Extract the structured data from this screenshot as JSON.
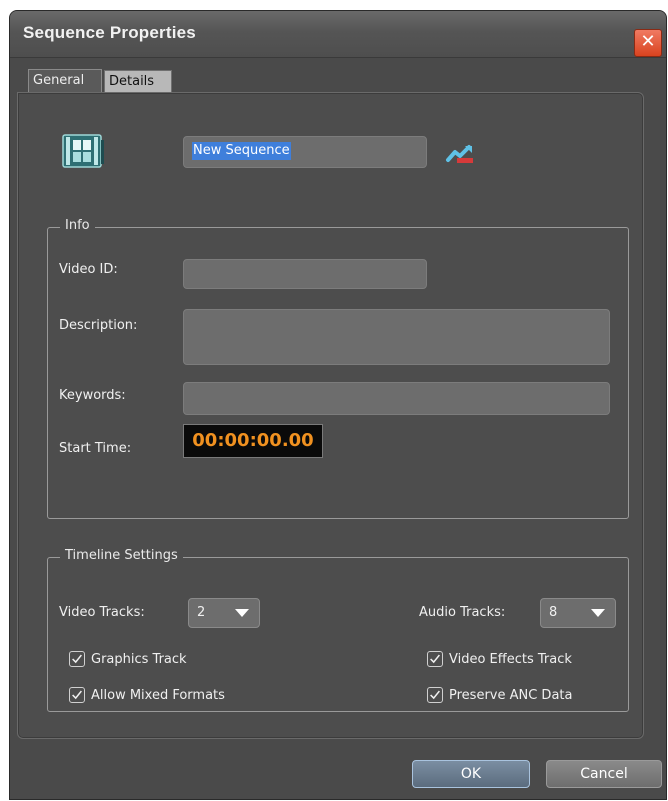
{
  "window": {
    "title": "Sequence Properties",
    "close_symbol": "✕"
  },
  "tabs": [
    {
      "label": "General",
      "active": true
    },
    {
      "label": "Details",
      "active": false
    }
  ],
  "sequence": {
    "name": "New Sequence"
  },
  "info": {
    "legend": "Info",
    "video_id": {
      "label": "Video ID:",
      "value": ""
    },
    "description": {
      "label": "Description:",
      "value": ""
    },
    "keywords": {
      "label": "Keywords:",
      "value": ""
    },
    "start_time": {
      "label": "Start Time:",
      "value": "00:00:00.00"
    }
  },
  "timeline": {
    "legend": "Timeline Settings",
    "video_tracks": {
      "label": "Video Tracks:",
      "value": "2"
    },
    "audio_tracks": {
      "label": "Audio Tracks:",
      "value": "8"
    },
    "graphics_track": {
      "label": "Graphics Track",
      "checked": true
    },
    "video_effects_track": {
      "label": "Video Effects Track",
      "checked": true
    },
    "allow_mixed_formats": {
      "label": "Allow Mixed Formats",
      "checked": true
    },
    "preserve_anc_data": {
      "label": "Preserve ANC Data",
      "checked": true
    }
  },
  "buttons": {
    "ok": "OK",
    "cancel": "Cancel"
  },
  "colors": {
    "accent_timecode": "#f09120",
    "selection": "#3f7fdb",
    "close": "#d9431f"
  },
  "icons": {
    "sequence": "film-strip-icon",
    "link": "link-arrow-icon",
    "check": "checkmark-icon",
    "dropdown": "chevron-down-icon"
  }
}
